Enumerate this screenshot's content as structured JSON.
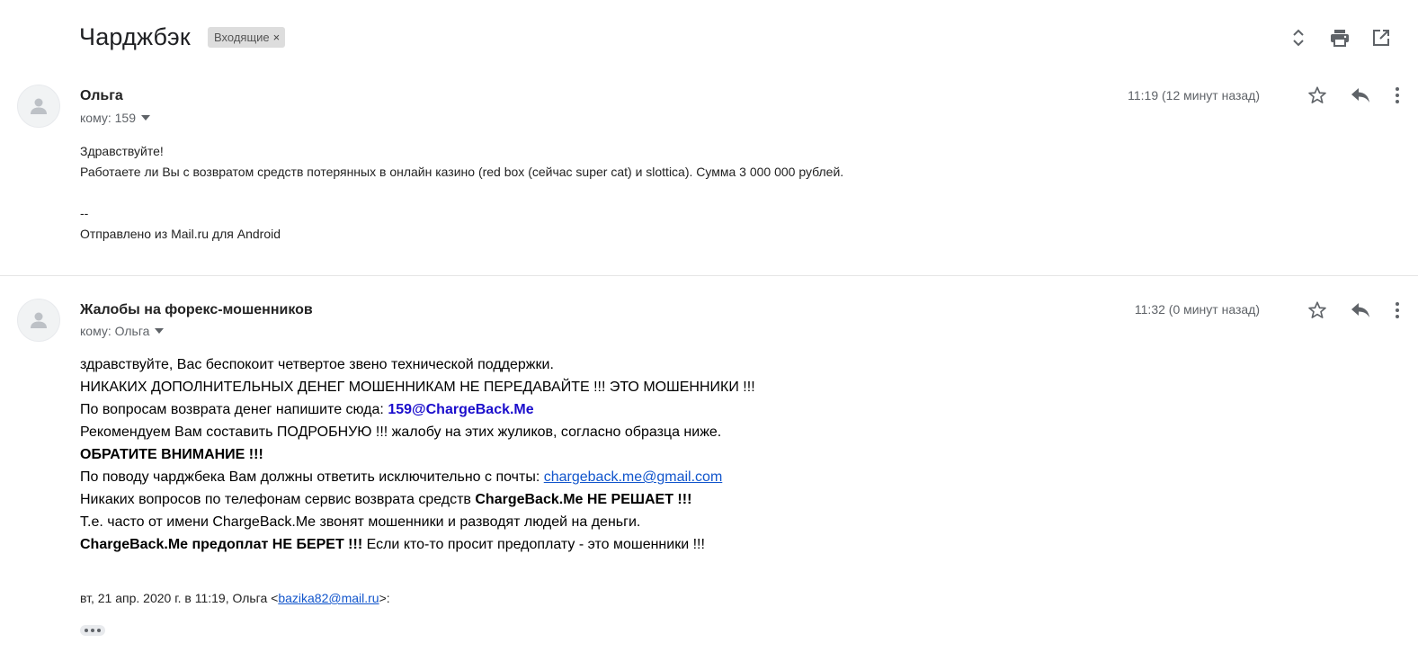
{
  "thread": {
    "subject": "Чарджбэк",
    "label": "Входящие",
    "label_remove": "×"
  },
  "toolbar_icons": [
    "expand-collapse-icon",
    "print-icon",
    "open-new-window-icon"
  ],
  "messages": [
    {
      "sender": "Ольга",
      "to_label": "кому: 159",
      "timestamp": "11:19 (12 минут назад)",
      "body": {
        "greeting": "Здравствуйте!",
        "text": "Работаете ли Вы с возвратом средств потерянных в онлайн казино (red box (сейчас super cat) и slottica). Сумма 3 000 000 рублей.",
        "sig_separator": "--",
        "signature": "Отправлено из Mail.ru для Android"
      }
    },
    {
      "sender": "Жалобы на форекс-мошенников",
      "to_label": "кому: Ольга",
      "timestamp": "11:32 (0 минут назад)",
      "body": {
        "line1": "здравствуйте, Вас беспокоит четвертое звено технической поддержки.",
        "line2": "НИКАКИХ ДОПОЛНИТЕЛЬНЫХ ДЕНЕГ МОШЕННИКАМ НЕ ПЕРЕДАВАЙТЕ !!! ЭТО МОШЕННИКИ !!!",
        "line3_prefix": "По вопросам возврата денег напишите сюда: ",
        "line3_email": "159@ChargeBack.Me",
        "line4": "Рекомендуем Вам составить ПОДРОБНУЮ !!! жалобу на этих жуликов, согласно образца ниже.",
        "line5": "ОБРАТИТЕ ВНИМАНИЕ !!!",
        "line6_prefix": "По поводу чарджбека Вам должны ответить исключительно с почты: ",
        "line6_link": "chargeback.me@gmail.com",
        "line7_prefix": "Никаких вопросов по телефонам сервис возврата средств ",
        "line7_bold": "ChargeBack.Me НЕ РЕШАЕТ !!!",
        "line8": "Т.е. часто от имени ChargeBack.Me звонят мошенники и разводят людей на деньги.",
        "line9_bold": "ChargeBack.Me предоплат НЕ БЕРЕТ !!!",
        "line9_rest": " Если кто-то просит предоплату - это мошенники !!!"
      },
      "quote": {
        "prefix": "вт, 21 апр. 2020 г. в 11:19, Ольга <",
        "email": "bazika82@mail.ru",
        "suffix": ">:"
      }
    }
  ],
  "colors": {
    "accent_link": "#1155cc",
    "email_blue": "#1a0dcc",
    "muted_text": "#5f6368",
    "chip_bg": "#dddddd"
  }
}
